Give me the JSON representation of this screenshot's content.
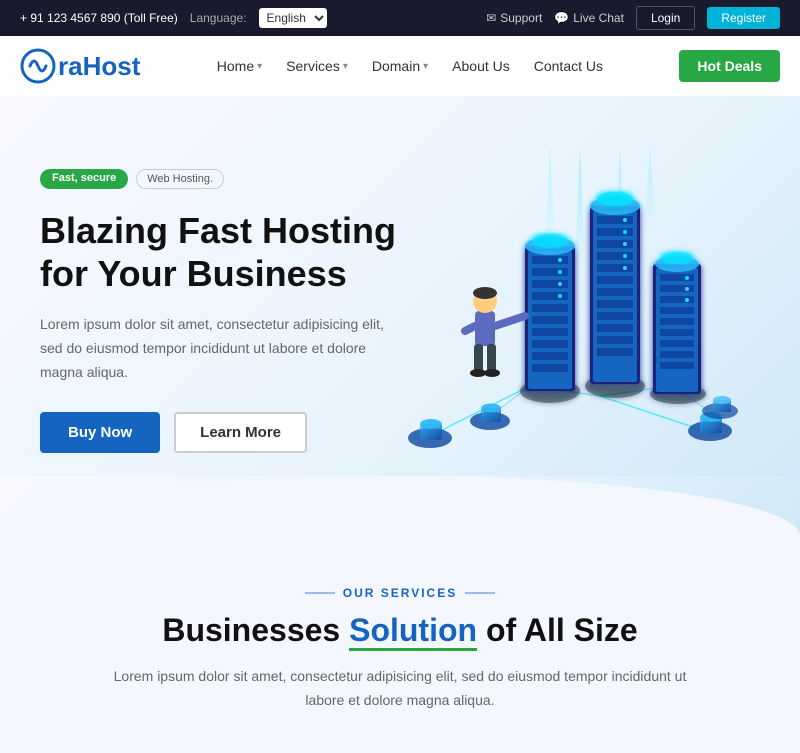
{
  "topbar": {
    "phone": "+ 91 123 4567 890 (Toll Free)",
    "language_label": "Language:",
    "language_default": "English",
    "support_label": "Support",
    "live_chat_label": "Live Chat",
    "login_label": "Login",
    "register_label": "Register"
  },
  "nav": {
    "logo_text": "raHost",
    "menu": [
      {
        "label": "Home",
        "has_dropdown": true
      },
      {
        "label": "Services",
        "has_dropdown": true
      },
      {
        "label": "Domain",
        "has_dropdown": true
      },
      {
        "label": "About Us",
        "has_dropdown": false
      },
      {
        "label": "Contact Us",
        "has_dropdown": false
      }
    ],
    "hot_deals": "Hot Deals"
  },
  "hero": {
    "badge_fast": "Fast, secure",
    "badge_web": "Web Hosting.",
    "title_line1": "Blazing Fast Hosting",
    "title_line2": "for Your Business",
    "description": "Lorem ipsum dolor sit amet, consectetur adipisicing elit, sed do eiusmod tempor incididunt ut labore et dolore magna aliqua.",
    "btn_buy": "Buy Now",
    "btn_learn": "Learn More"
  },
  "services": {
    "label": "OUR SERVICES",
    "title_part1": "Businesses",
    "title_highlight": "Solution",
    "title_part2": "of All Size",
    "description": "Lorem ipsum dolor sit amet, consectetur adipisicing elit, sed do eiusmod tempor incididunt ut labore et\ndolore magna aliqua."
  }
}
